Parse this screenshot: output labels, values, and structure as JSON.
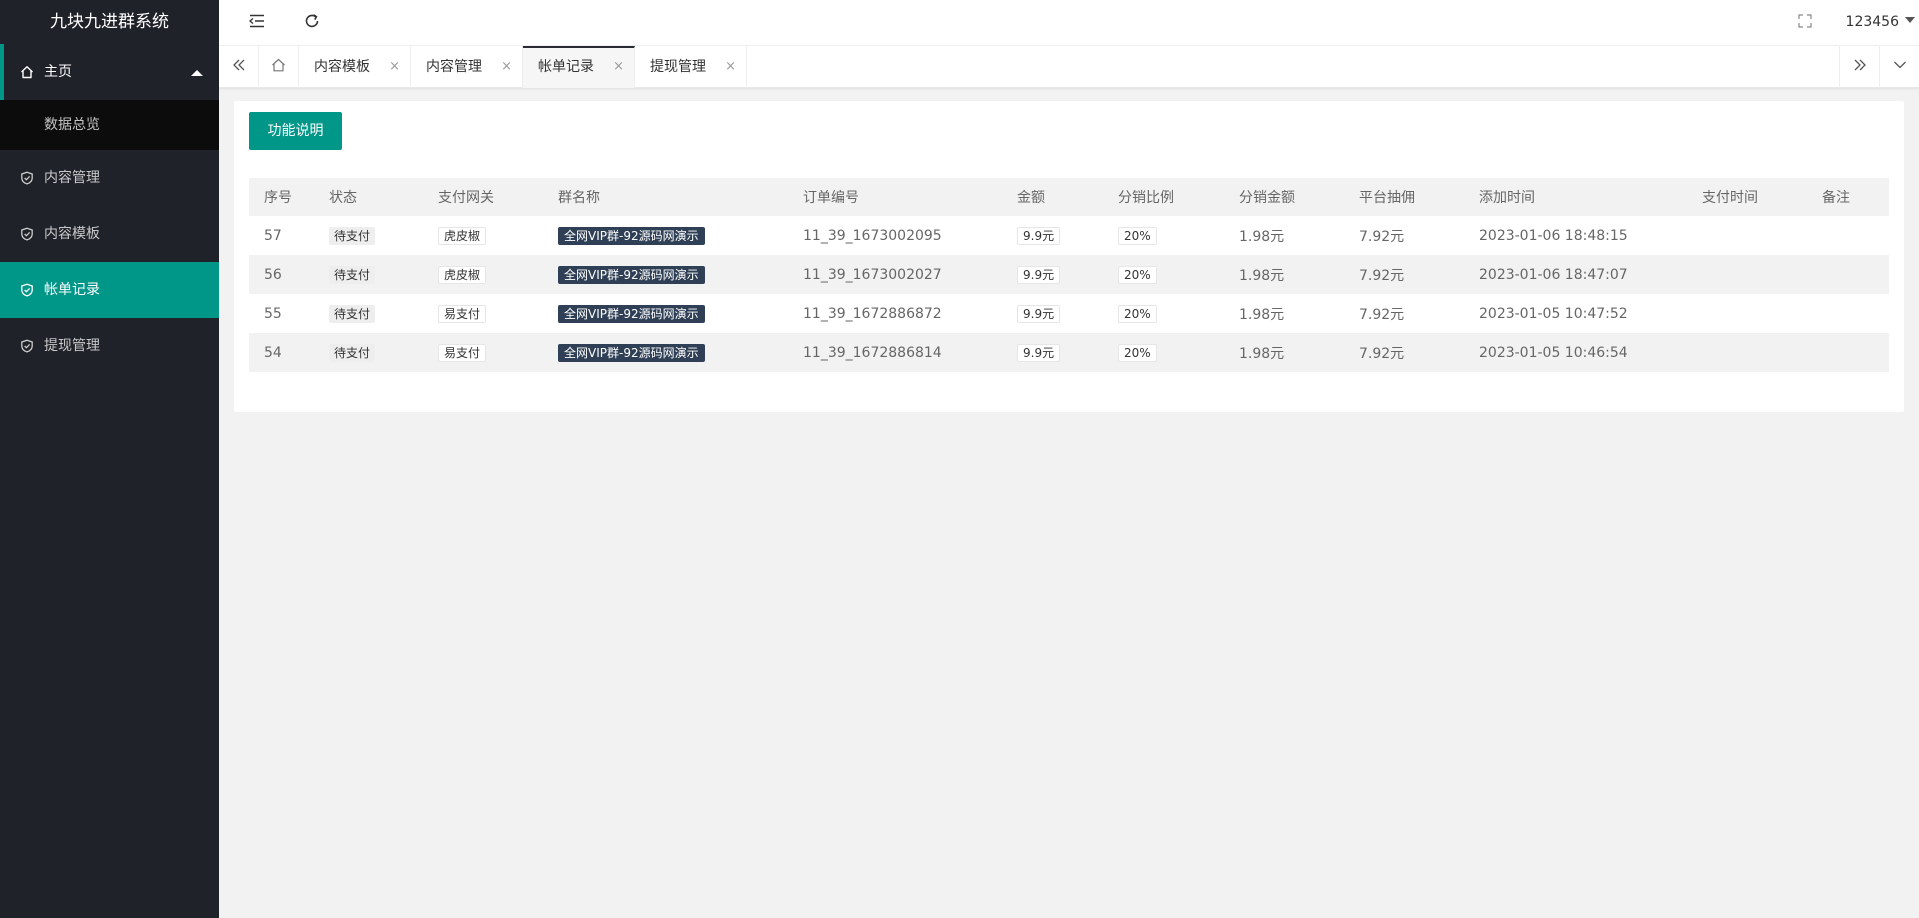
{
  "app": {
    "title": "九块九进群系统"
  },
  "sidebar": {
    "parent": {
      "label": "主页",
      "icon": "home-icon"
    },
    "submenu": [
      {
        "label": "数据总览"
      }
    ],
    "items": [
      {
        "label": "内容管理",
        "icon": "shield-check-icon"
      },
      {
        "label": "内容模板",
        "icon": "shield-check-icon"
      },
      {
        "label": "帐单记录",
        "icon": "shield-check-icon",
        "active": true
      },
      {
        "label": "提现管理",
        "icon": "shield-check-icon"
      }
    ]
  },
  "header": {
    "user": "123456"
  },
  "tabs": [
    {
      "label": "内容模板"
    },
    {
      "label": "内容管理"
    },
    {
      "label": "帐单记录",
      "active": true
    },
    {
      "label": "提现管理"
    }
  ],
  "tab_close_glyph": "×",
  "main": {
    "help_button": "功能说明",
    "table": {
      "columns": [
        "序号",
        "状态",
        "支付网关",
        "群名称",
        "订单编号",
        "金额",
        "分销比例",
        "分销金额",
        "平台抽佣",
        "添加时间",
        "支付时间",
        "备注"
      ],
      "rows": [
        {
          "id": "57",
          "status": "待支付",
          "gateway": "虎皮椒",
          "group": "全网VIP群-92源码网演示",
          "order": "11_39_1673002095",
          "amount": "9.9元",
          "ratio": "20%",
          "dist_amount": "1.98元",
          "commission": "7.92元",
          "added": "2023-01-06 18:48:15",
          "paid": "",
          "note": ""
        },
        {
          "id": "56",
          "status": "待支付",
          "gateway": "虎皮椒",
          "group": "全网VIP群-92源码网演示",
          "order": "11_39_1673002027",
          "amount": "9.9元",
          "ratio": "20%",
          "dist_amount": "1.98元",
          "commission": "7.92元",
          "added": "2023-01-06 18:47:07",
          "paid": "",
          "note": ""
        },
        {
          "id": "55",
          "status": "待支付",
          "gateway": "易支付",
          "group": "全网VIP群-92源码网演示",
          "order": "11_39_1672886872",
          "amount": "9.9元",
          "ratio": "20%",
          "dist_amount": "1.98元",
          "commission": "7.92元",
          "added": "2023-01-05 10:47:52",
          "paid": "",
          "note": ""
        },
        {
          "id": "54",
          "status": "待支付",
          "gateway": "易支付",
          "group": "全网VIP群-92源码网演示",
          "order": "11_39_1672886814",
          "amount": "9.9元",
          "ratio": "20%",
          "dist_amount": "1.98元",
          "commission": "7.92元",
          "added": "2023-01-05 10:46:54",
          "paid": "",
          "note": ""
        }
      ]
    }
  },
  "colors": {
    "accent": "#009688",
    "sidebar_bg": "#20222a",
    "tag_dark": "#2f4056"
  }
}
